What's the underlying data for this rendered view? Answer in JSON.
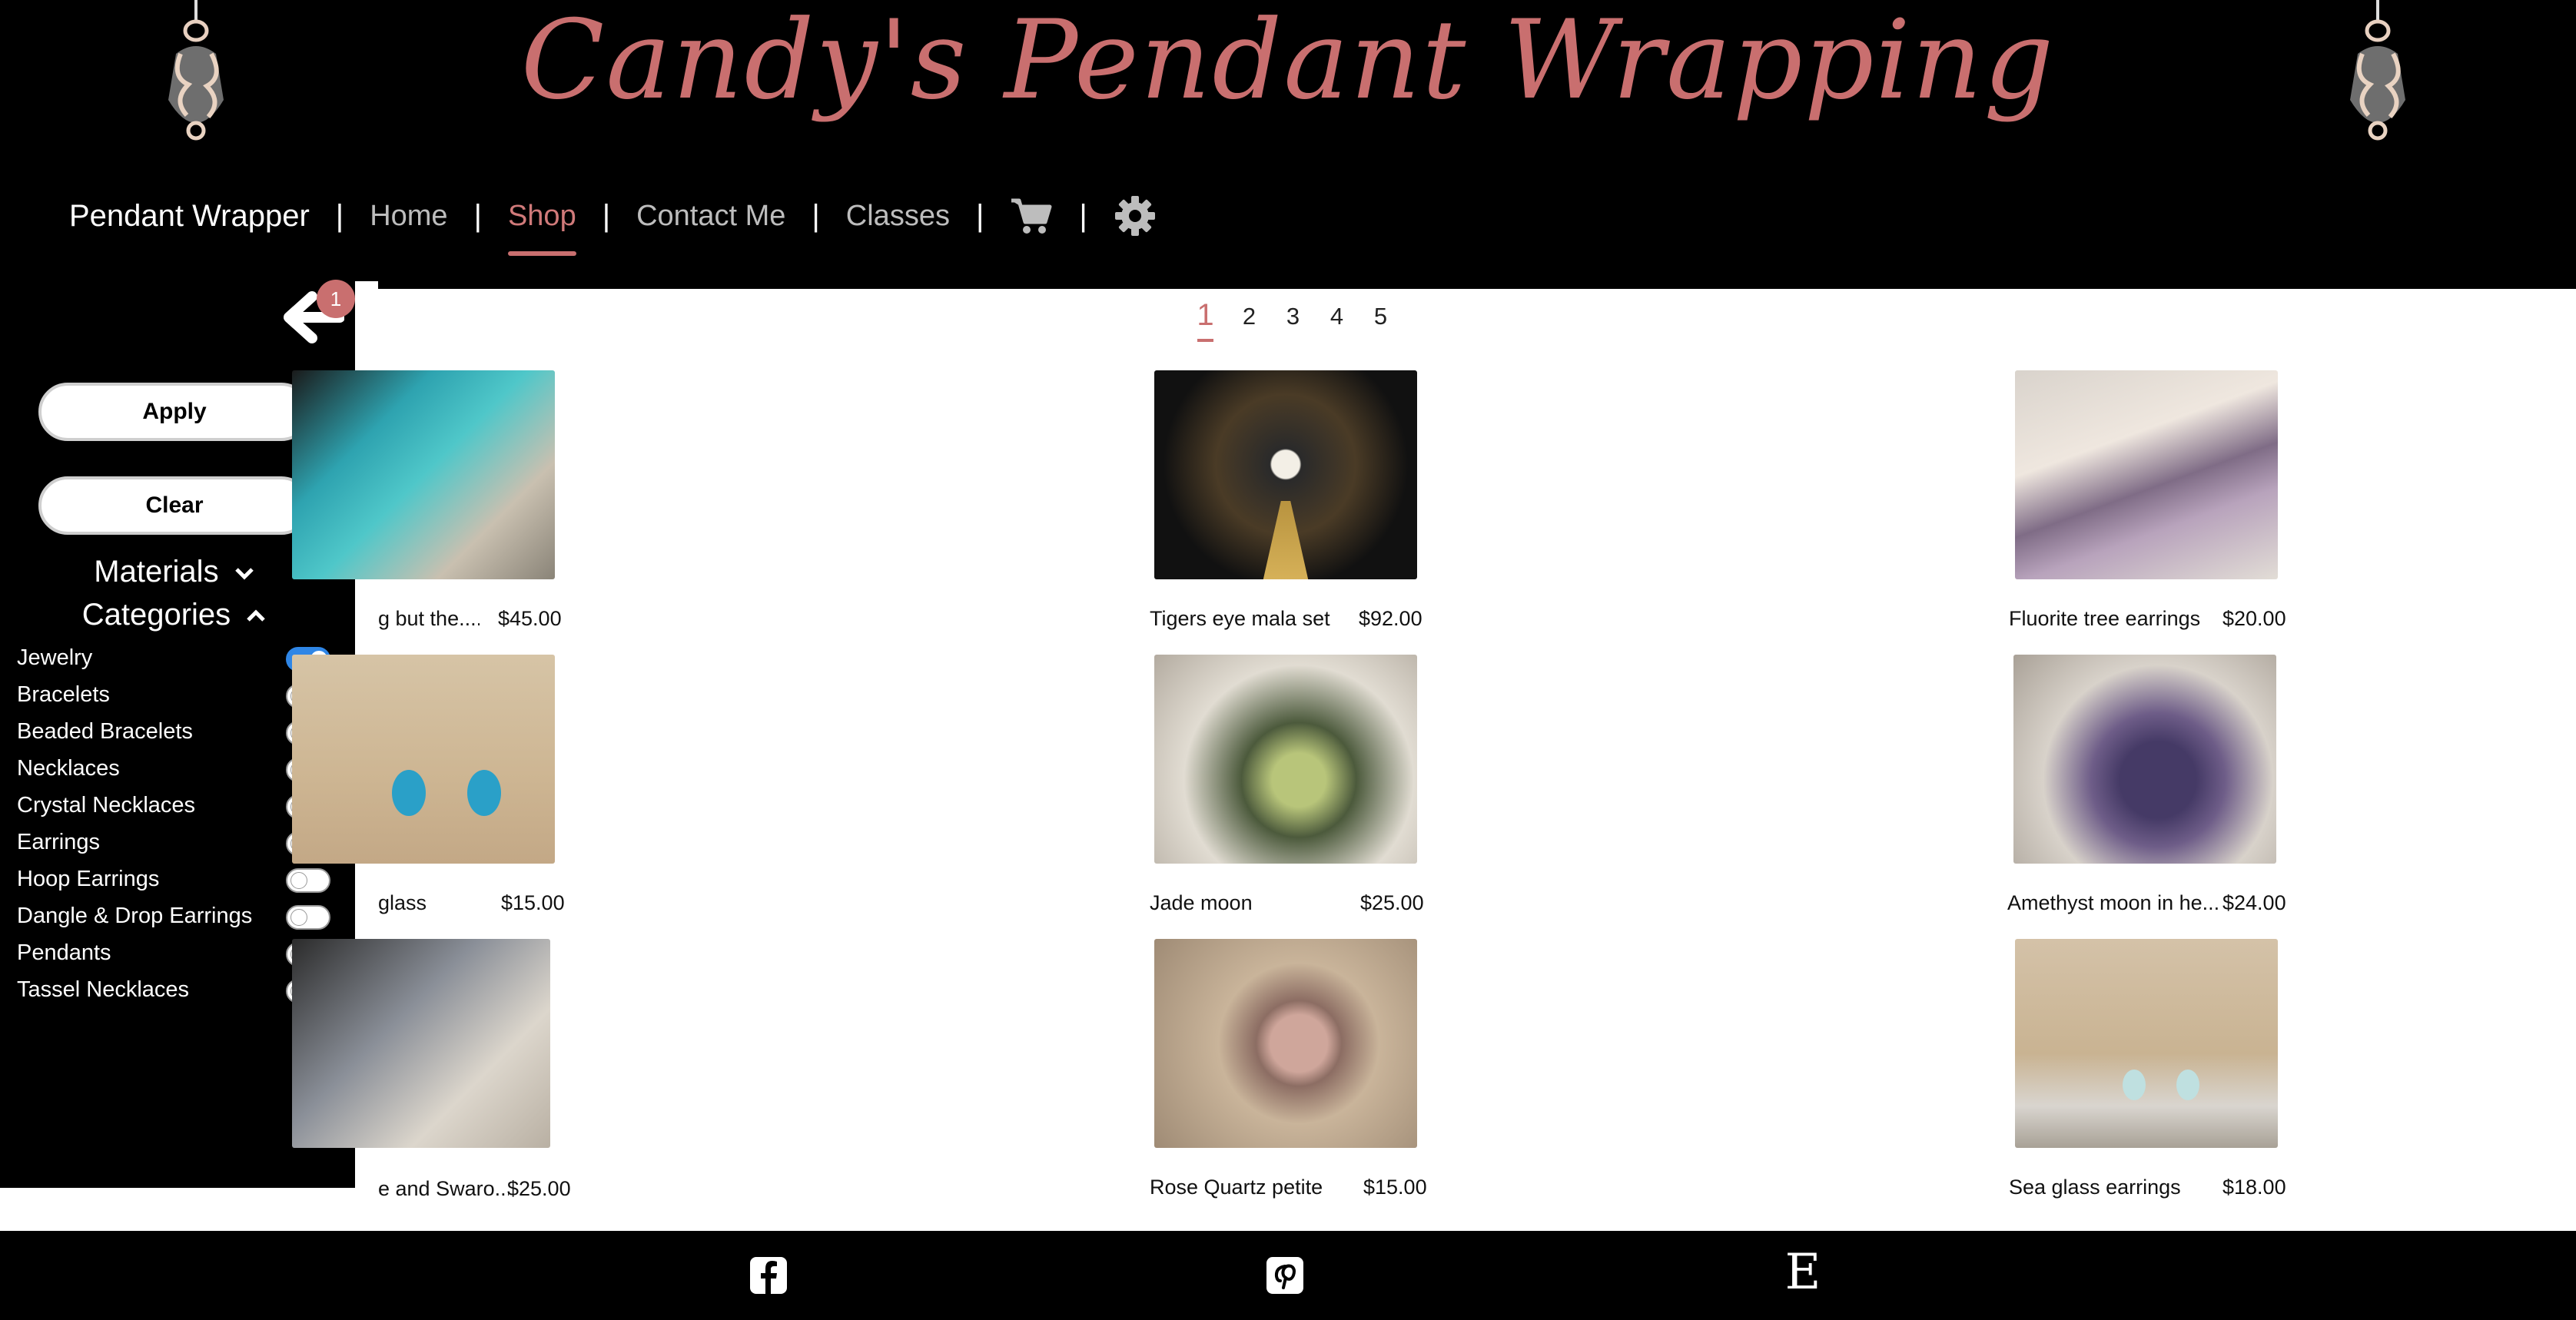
{
  "site": {
    "title": "Candy's Pendant Wrapping"
  },
  "nav": {
    "brand": "Pendant Wrapper",
    "separator": "|",
    "items": [
      {
        "label": "Home",
        "active": false
      },
      {
        "label": "Shop",
        "active": true
      },
      {
        "label": "Contact Me",
        "active": false
      },
      {
        "label": "Classes",
        "active": false
      }
    ],
    "icons": [
      "cart-icon",
      "gear-icon"
    ]
  },
  "sidebar": {
    "badge_count": "1",
    "apply_label": "Apply",
    "clear_label": "Clear",
    "materials_label": "Materials",
    "categories_label": "Categories",
    "categories": [
      {
        "label": "Jewelry",
        "on": true
      },
      {
        "label": "Bracelets",
        "on": false
      },
      {
        "label": "Beaded Bracelets",
        "on": false
      },
      {
        "label": "Necklaces",
        "on": false
      },
      {
        "label": "Crystal Necklaces",
        "on": false
      },
      {
        "label": "Earrings",
        "on": false
      },
      {
        "label": "Hoop Earrings",
        "on": false
      },
      {
        "label": "Dangle & Drop Earrings",
        "on": false
      },
      {
        "label": "Pendants",
        "on": false
      },
      {
        "label": "Tassel Necklaces",
        "on": false
      }
    ]
  },
  "pagination": {
    "pages": [
      "1",
      "2",
      "3",
      "4",
      "5"
    ],
    "current": "1"
  },
  "products": [
    {
      "name": "g but the....",
      "price": "$45.00"
    },
    {
      "name": "Tigers eye mala set",
      "price": "$92.00"
    },
    {
      "name": "Fluorite tree earrings",
      "price": "$20.00"
    },
    {
      "name": "glass",
      "price": "$15.00"
    },
    {
      "name": "Jade moon",
      "price": "$25.00"
    },
    {
      "name": "Amethyst moon in he...",
      "price": "$24.00"
    },
    {
      "name": "e and Swaro...",
      "price": "$25.00"
    },
    {
      "name": "Rose Quartz petite",
      "price": "$15.00"
    },
    {
      "name": "Sea glass earrings",
      "price": "$18.00"
    }
  ],
  "footer": {
    "icons": [
      "facebook-icon",
      "pinterest-icon",
      "etsy-icon"
    ],
    "etsy_letter": "E"
  },
  "colors": {
    "accent": "#c96f6f",
    "header_bg": "#000000",
    "toggle_on": "#2f86e6"
  }
}
